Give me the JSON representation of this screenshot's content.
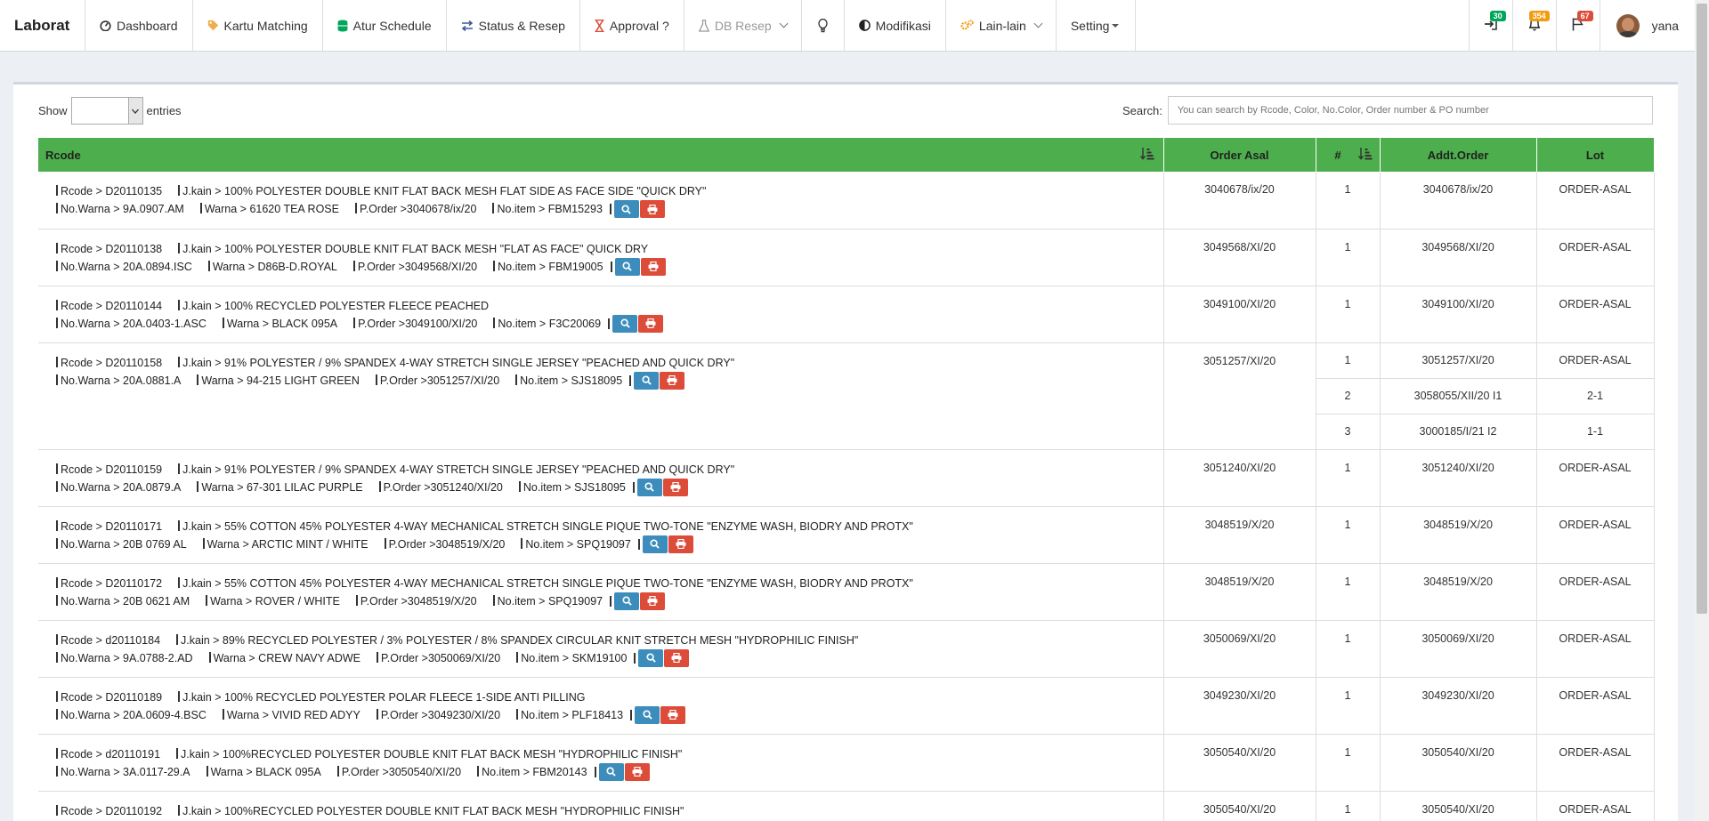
{
  "nav": {
    "brand": "Laborat",
    "items": [
      {
        "label": "Dashboard",
        "icon": "dashboard-icon"
      },
      {
        "label": "Kartu Matching",
        "icon": "tag-icon"
      },
      {
        "label": "Atur Schedule",
        "icon": "database-icon"
      },
      {
        "label": "Status & Resep",
        "icon": "exchange-icon"
      },
      {
        "label": "Approval ?",
        "icon": "hourglass-icon"
      },
      {
        "label": "DB Resep",
        "icon": "flask-icon"
      },
      {
        "label": "",
        "icon": "bulb-icon"
      },
      {
        "label": "Modifikasi",
        "icon": "adjust-icon"
      },
      {
        "label": "Lain-lain",
        "icon": "cogs-icon"
      },
      {
        "label": "Setting",
        "icon": ""
      }
    ],
    "badges": {
      "login": "30",
      "bell": "354",
      "flag": "67"
    },
    "badge_colors": {
      "login": "#00a65a",
      "bell": "#f39c12",
      "flag": "#dd4b39"
    },
    "user": "yana"
  },
  "controls": {
    "show_label": "Show",
    "entries_label": "entries",
    "search_label": "Search:",
    "search_placeholder": "You can search by Rcode, Color, No.Color, Order number & PO number"
  },
  "table": {
    "headers": {
      "rcode": "Rcode",
      "order_asal": "Order Asal",
      "num": "#",
      "addt_order": "Addt.Order",
      "lot": "Lot"
    },
    "rows": [
      {
        "rcode": "Rcode > D20110135",
        "jkain": "J.kain > 100% POLYESTER DOUBLE KNIT FLAT BACK MESH FLAT SIDE AS FACE SIDE \"QUICK DRY\"",
        "nowarna": "No.Warna > 9A.0907.AM",
        "warna": "Warna > 61620 TEA ROSE",
        "porder": "P.Order >3040678/ix/20",
        "noitem": "No.item > FBM15293",
        "order_asal": "3040678/ix/20",
        "subs": [
          {
            "num": "1",
            "addt": "3040678/ix/20",
            "lot": "ORDER-ASAL"
          }
        ]
      },
      {
        "rcode": "Rcode > D20110138",
        "jkain": "J.kain > 100% POLYESTER DOUBLE KNIT FLAT BACK MESH \"FLAT AS FACE\" QUICK DRY",
        "nowarna": "No.Warna > 20A.0894.ISC",
        "warna": "Warna > D86B-D.ROYAL",
        "porder": "P.Order >3049568/XI/20",
        "noitem": "No.item > FBM19005",
        "order_asal": "3049568/XI/20",
        "subs": [
          {
            "num": "1",
            "addt": "3049568/XI/20",
            "lot": "ORDER-ASAL"
          }
        ]
      },
      {
        "rcode": "Rcode > D20110144",
        "jkain": "J.kain > 100% RECYCLED POLYESTER FLEECE PEACHED",
        "nowarna": "No.Warna > 20A.0403-1.ASC",
        "warna": "Warna > BLACK 095A",
        "porder": "P.Order >3049100/XI/20",
        "noitem": "No.item > F3C20069",
        "order_asal": "3049100/XI/20",
        "subs": [
          {
            "num": "1",
            "addt": "3049100/XI/20",
            "lot": "ORDER-ASAL"
          }
        ]
      },
      {
        "rcode": "Rcode > D20110158",
        "jkain": "J.kain > 91% POLYESTER / 9% SPANDEX 4-WAY STRETCH SINGLE JERSEY \"PEACHED AND QUICK DRY\"",
        "nowarna": "No.Warna > 20A.0881.A",
        "warna": "Warna > 94-215 LIGHT GREEN",
        "porder": "P.Order >3051257/XI/20",
        "noitem": "No.item > SJS18095",
        "order_asal": "3051257/XI/20",
        "subs": [
          {
            "num": "1",
            "addt": "3051257/XI/20",
            "lot": "ORDER-ASAL"
          },
          {
            "num": "2",
            "addt": "3058055/XII/20 I1",
            "lot": "2-1"
          },
          {
            "num": "3",
            "addt": "3000185/I/21 I2",
            "lot": "1-1"
          }
        ]
      },
      {
        "rcode": "Rcode > D20110159",
        "jkain": "J.kain > 91% POLYESTER / 9% SPANDEX 4-WAY STRETCH SINGLE JERSEY \"PEACHED AND QUICK DRY\"",
        "nowarna": "No.Warna > 20A.0879.A",
        "warna": "Warna > 67-301 LILAC PURPLE",
        "porder": "P.Order >3051240/XI/20",
        "noitem": "No.item > SJS18095",
        "order_asal": "3051240/XI/20",
        "subs": [
          {
            "num": "1",
            "addt": "3051240/XI/20",
            "lot": "ORDER-ASAL"
          }
        ]
      },
      {
        "rcode": "Rcode > D20110171",
        "jkain": "J.kain > 55% COTTON 45% POLYESTER 4-WAY MECHANICAL STRETCH SINGLE PIQUE TWO-TONE \"ENZYME WASH, BIODRY AND PROTX\"",
        "nowarna": "No.Warna > 20B 0769 AL",
        "warna": "Warna > ARCTIC MINT / WHITE",
        "porder": "P.Order >3048519/X/20",
        "noitem": "No.item > SPQ19097",
        "order_asal": "3048519/X/20",
        "subs": [
          {
            "num": "1",
            "addt": "3048519/X/20",
            "lot": "ORDER-ASAL"
          }
        ]
      },
      {
        "rcode": "Rcode > D20110172",
        "jkain": "J.kain > 55% COTTON 45% POLYESTER 4-WAY MECHANICAL STRETCH SINGLE PIQUE TWO-TONE \"ENZYME WASH, BIODRY AND PROTX\"",
        "nowarna": "No.Warna > 20B 0621 AM",
        "warna": "Warna > ROVER / WHITE",
        "porder": "P.Order >3048519/X/20",
        "noitem": "No.item > SPQ19097",
        "order_asal": "3048519/X/20",
        "subs": [
          {
            "num": "1",
            "addt": "3048519/X/20",
            "lot": "ORDER-ASAL"
          }
        ]
      },
      {
        "rcode": "Rcode > d20110184",
        "jkain": "J.kain > 89% RECYCLED POLYESTER / 3% POLYESTER / 8% SPANDEX CIRCULAR KNIT STRETCH MESH \"HYDROPHILIC FINISH\"",
        "nowarna": "No.Warna > 9A.0788-2.AD",
        "warna": "Warna > CREW NAVY ADWE",
        "porder": "P.Order >3050069/XI/20",
        "noitem": "No.item > SKM19100",
        "order_asal": "3050069/XI/20",
        "subs": [
          {
            "num": "1",
            "addt": "3050069/XI/20",
            "lot": "ORDER-ASAL"
          }
        ]
      },
      {
        "rcode": "Rcode > D20110189",
        "jkain": "J.kain > 100% RECYCLED POLYESTER POLAR FLEECE 1-SIDE ANTI PILLING",
        "nowarna": "No.Warna > 20A.0609-4.BSC",
        "warna": "Warna > VIVID RED ADYY",
        "porder": "P.Order >3049230/XI/20",
        "noitem": "No.item > PLF18413",
        "order_asal": "3049230/XI/20",
        "subs": [
          {
            "num": "1",
            "addt": "3049230/XI/20",
            "lot": "ORDER-ASAL"
          }
        ]
      },
      {
        "rcode": "Rcode > d20110191",
        "jkain": "J.kain > 100%RECYCLED POLYESTER DOUBLE KNIT FLAT BACK MESH \"HYDROPHILIC FINISH\"",
        "nowarna": "No.Warna > 3A.0117-29.A",
        "warna": "Warna > BLACK 095A",
        "porder": "P.Order >3050540/XI/20",
        "noitem": "No.item > FBM20143",
        "order_asal": "3050540/XI/20",
        "subs": [
          {
            "num": "1",
            "addt": "3050540/XI/20",
            "lot": "ORDER-ASAL"
          }
        ]
      },
      {
        "rcode": "Rcode > D20110192",
        "jkain": "J.kain > 100%RECYCLED POLYESTER DOUBLE KNIT FLAT BACK MESH \"HYDROPHILIC FINISH\"",
        "nowarna": "",
        "warna": "",
        "porder": "",
        "noitem": "",
        "order_asal": "3050540/XI/20",
        "subs": [
          {
            "num": "1",
            "addt": "3050540/XI/20",
            "lot": "ORDER-ASAL"
          }
        ]
      }
    ]
  }
}
